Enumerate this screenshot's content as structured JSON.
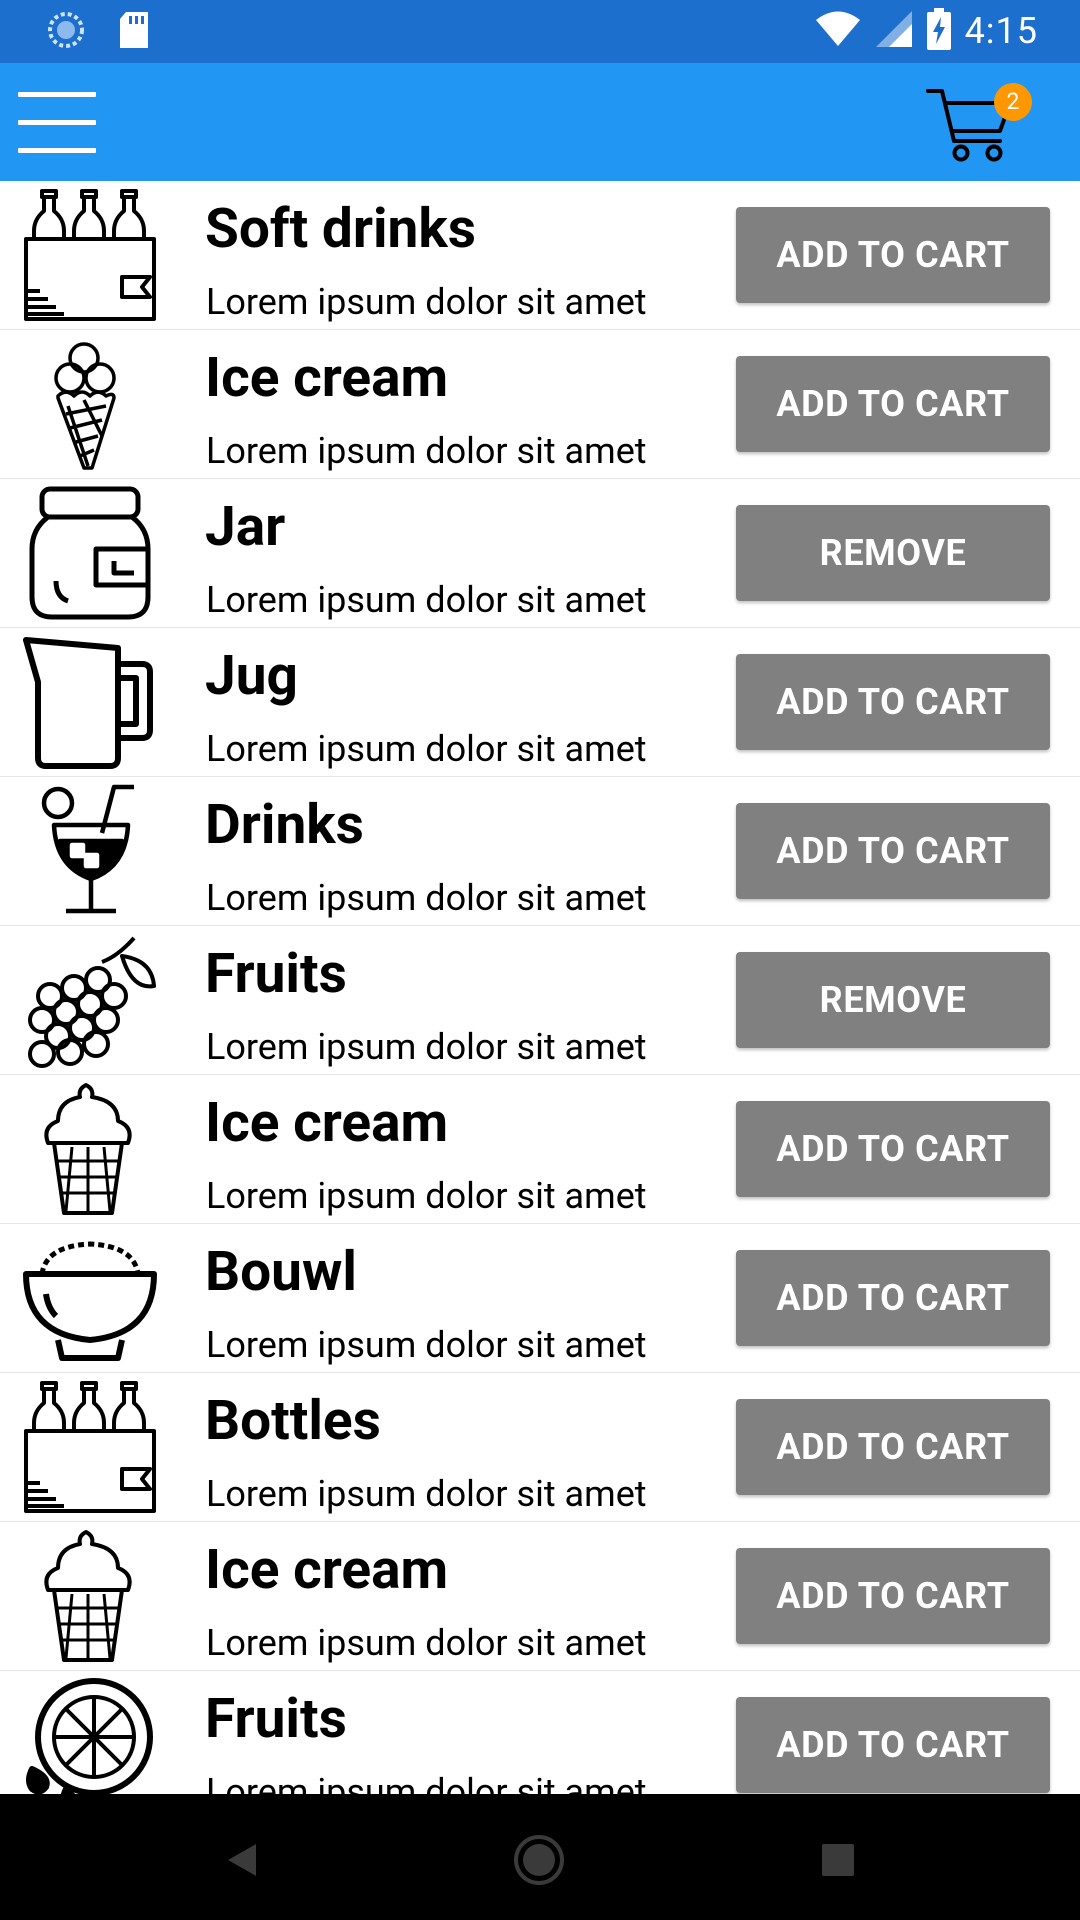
{
  "status_bar": {
    "time": "4:15",
    "icons": [
      "sync-icon",
      "sd-card-icon",
      "wifi-icon",
      "signal-icon",
      "battery-charging-icon"
    ]
  },
  "app_bar": {
    "menu_icon": "hamburger-menu-icon",
    "cart_icon": "shopping-cart-icon",
    "cart_count": "2",
    "colors": {
      "status_bar": "#1d6fce",
      "app_bar": "#2196f3",
      "badge": "#ff9800",
      "button": "#808080"
    }
  },
  "items": [
    {
      "title": "Soft drinks",
      "subtitle": "Lorem ipsum dolor sit amet",
      "action": "ADD TO CART",
      "icon": "bottle-crate-icon"
    },
    {
      "title": "Ice cream",
      "subtitle": "Lorem ipsum dolor sit amet",
      "action": "ADD TO CART",
      "icon": "ice-cream-cone-icon"
    },
    {
      "title": "Jar",
      "subtitle": "Lorem ipsum dolor sit amet",
      "action": "REMOVE",
      "icon": "jar-icon"
    },
    {
      "title": "Jug",
      "subtitle": "Lorem ipsum dolor sit amet",
      "action": "ADD TO CART",
      "icon": "jug-icon"
    },
    {
      "title": "Drinks",
      "subtitle": "Lorem ipsum dolor sit amet",
      "action": "ADD TO CART",
      "icon": "cocktail-icon"
    },
    {
      "title": "Fruits",
      "subtitle": "Lorem ipsum dolor sit amet",
      "action": "REMOVE",
      "icon": "grapes-icon"
    },
    {
      "title": "Ice cream",
      "subtitle": "Lorem ipsum dolor sit amet",
      "action": "ADD TO CART",
      "icon": "soft-serve-icon"
    },
    {
      "title": "Bouwl",
      "subtitle": "Lorem ipsum dolor sit amet",
      "action": "ADD TO CART",
      "icon": "bowl-icon"
    },
    {
      "title": "Bottles",
      "subtitle": "Lorem ipsum dolor sit amet",
      "action": "ADD TO CART",
      "icon": "bottle-crate-icon"
    },
    {
      "title": "Ice cream",
      "subtitle": "Lorem ipsum dolor sit amet",
      "action": "ADD TO CART",
      "icon": "soft-serve-icon"
    },
    {
      "title": "Fruits",
      "subtitle": "Lorem ipsum dolor sit amet",
      "action": "ADD TO CART",
      "icon": "citrus-slice-icon"
    }
  ],
  "nav_bar": {
    "icons": [
      "back-icon",
      "home-icon",
      "recents-icon"
    ]
  }
}
